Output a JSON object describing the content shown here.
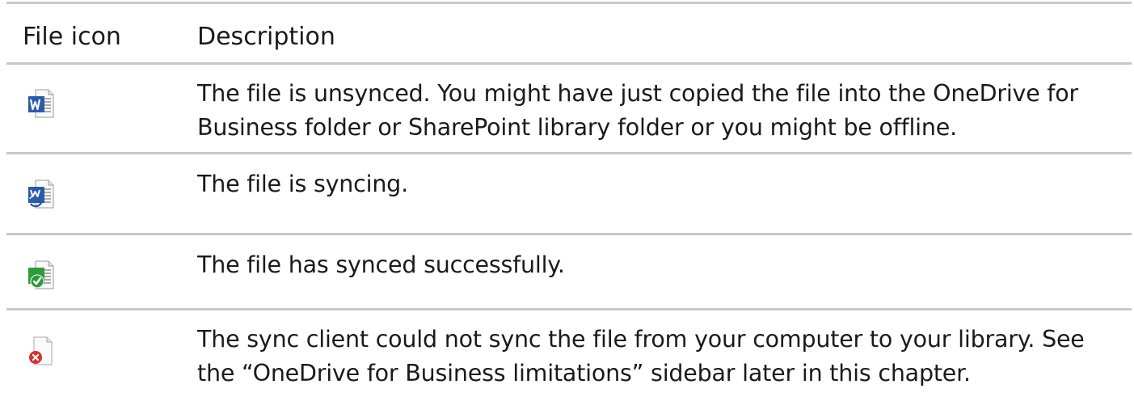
{
  "table": {
    "headers": {
      "file_icon": "File icon",
      "description": "Description"
    },
    "rows": [
      {
        "icon": "word-doc-unsynced-icon",
        "description_lines": [
          "The file is unsynced. You might have just copied the file into the OneDrive for",
          "Business folder or SharePoint library folder or you might be offline."
        ]
      },
      {
        "icon": "word-doc-syncing-icon",
        "description_lines": [
          "The file is syncing."
        ]
      },
      {
        "icon": "word-doc-synced-icon",
        "description_lines": [
          "The file has synced successfully."
        ]
      },
      {
        "icon": "doc-sync-error-icon",
        "description_lines": [
          "The sync client could not sync the file from your computer to your library. See",
          "the “OneDrive for Business limitations” sidebar later in this chapter."
        ]
      }
    ]
  },
  "colors": {
    "rule": "#c8c8c8",
    "word_blue": "#2b5aa8",
    "sync_green": "#2e9b3a",
    "error_red": "#d6322f"
  }
}
